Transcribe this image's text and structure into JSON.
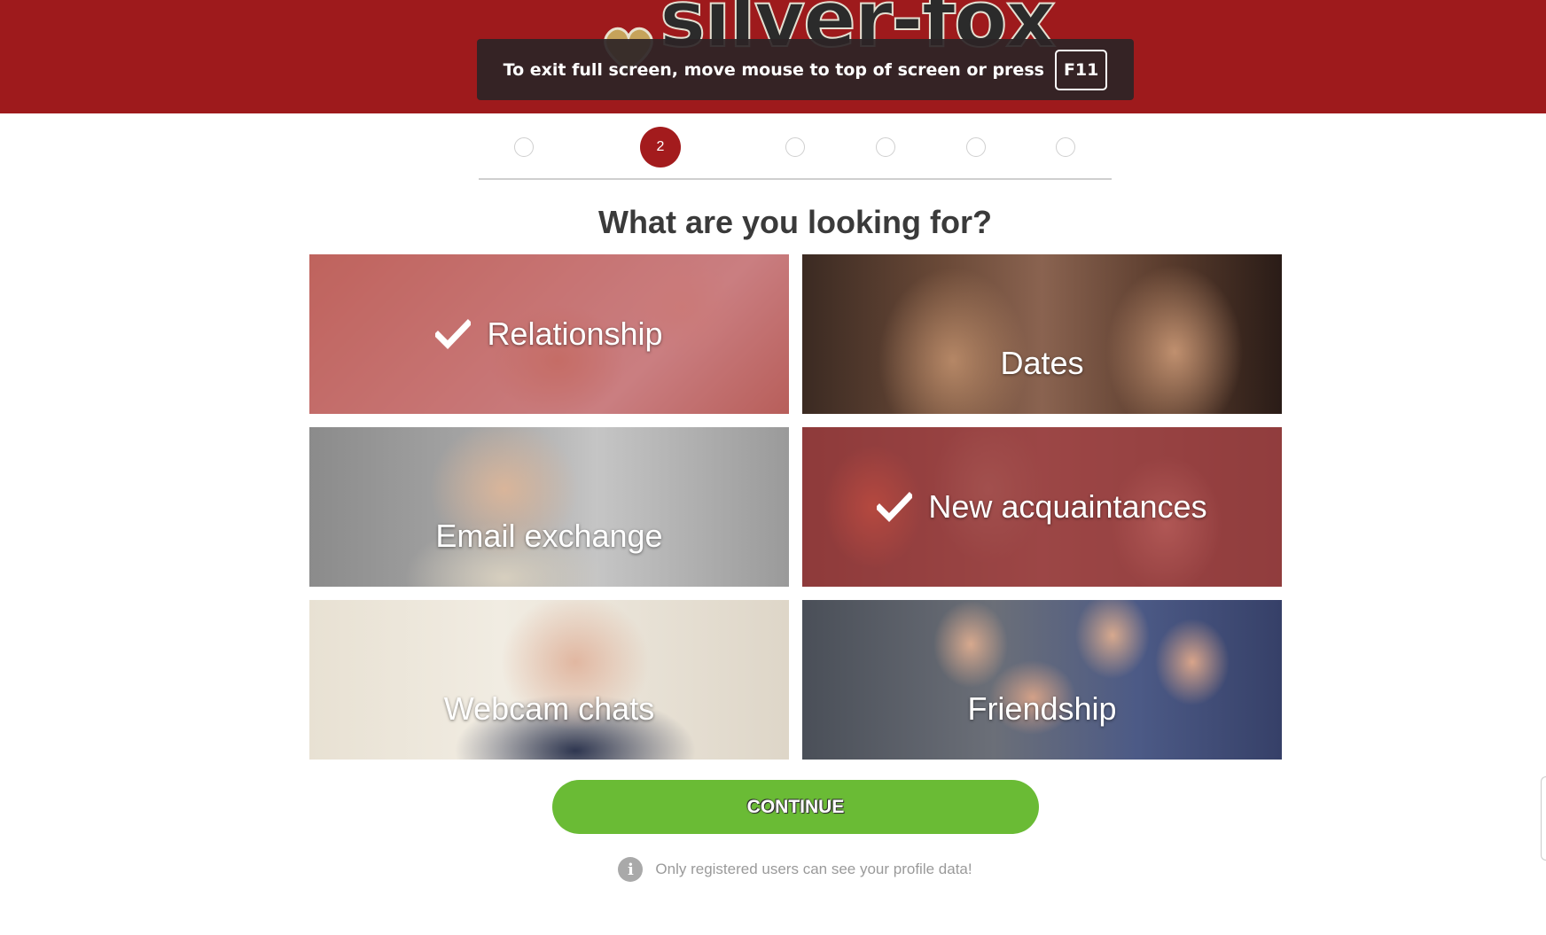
{
  "header": {
    "brand": "silver-fox",
    "brand_color": "#9e1a1c",
    "fullscreen_notice": {
      "text": "To exit full screen, move mouse to top of screen or press",
      "key": "F11"
    }
  },
  "stepper": {
    "current_step": "2",
    "total_steps": 6,
    "active_color": "#a31b1d"
  },
  "page": {
    "title": "What are you looking for?"
  },
  "options": [
    {
      "label": "Relationship",
      "selected": true
    },
    {
      "label": "Dates",
      "selected": false
    },
    {
      "label": "Email exchange",
      "selected": false
    },
    {
      "label": "New acquaintances",
      "selected": true
    },
    {
      "label": "Webcam chats",
      "selected": false
    },
    {
      "label": "Friendship",
      "selected": false
    }
  ],
  "actions": {
    "continue_label": "CONTINUE",
    "continue_color": "#6abb35"
  },
  "privacy_note": {
    "icon": "info-icon",
    "text": "Only registered users can see your profile data!"
  }
}
